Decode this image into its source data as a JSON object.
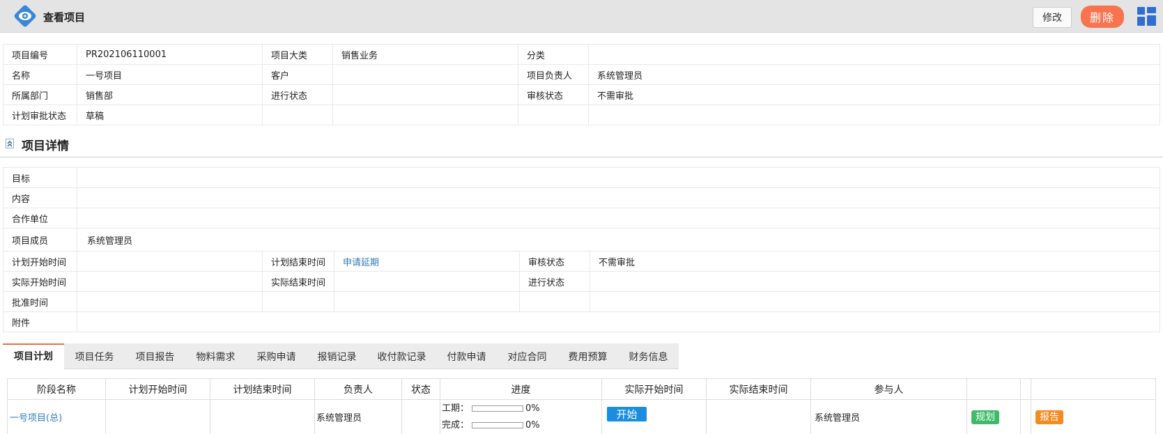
{
  "header": {
    "title": "查看项目",
    "edit_label": "修改",
    "delete_label": "删除",
    "brand_color": "#3a86d8",
    "delete_color": "#f7744f"
  },
  "basic_info": {
    "rows": [
      [
        {
          "label": "项目编号",
          "value": "PR202106110001"
        },
        {
          "label": "项目大类",
          "value": "销售业务"
        },
        {
          "label": "分类",
          "value": ""
        }
      ],
      [
        {
          "label": "名称",
          "value": "一号项目"
        },
        {
          "label": "客户",
          "value": ""
        },
        {
          "label": "项目负责人",
          "value": "系统管理员"
        }
      ],
      [
        {
          "label": "所属部门",
          "value": "销售部"
        },
        {
          "label": "进行状态",
          "value": ""
        },
        {
          "label": "审核状态",
          "value": "不需审批"
        }
      ],
      [
        {
          "label": "计划审批状态",
          "value": "草稿"
        },
        {
          "label": "",
          "value": ""
        },
        {
          "label": "",
          "value": ""
        }
      ]
    ]
  },
  "details": {
    "title": "项目详情",
    "goal_label": "目标",
    "goal_value": "",
    "content_label": "内容",
    "content_value": "",
    "partner_label": "合作单位",
    "partner_value": "",
    "members_label": "项目成员",
    "members_value": "系统管理员",
    "plan_start_label": "计划开始时间",
    "plan_start_value": "",
    "plan_end_label": "计划结束时间",
    "plan_end_link": "申请延期",
    "audit_label": "审核状态",
    "audit_value": "不需审批",
    "actual_start_label": "实际开始时间",
    "actual_start_value": "",
    "actual_end_label": "实际结束时间",
    "actual_end_value": "",
    "progress_status_label": "进行状态",
    "progress_status_value": "",
    "approve_label": "批准时间",
    "approve_value": "",
    "attachment_label": "附件",
    "attachment_value": ""
  },
  "tabs": [
    "项目计划",
    "项目任务",
    "项目报告",
    "物料需求",
    "采购申请",
    "报销记录",
    "收付款记录",
    "付款申请",
    "对应合同",
    "费用预算",
    "财务信息"
  ],
  "active_tab": 0,
  "plan_table": {
    "headers": [
      "阶段名称",
      "计划开始时间",
      "计划结束时间",
      "负责人",
      "状态",
      "进度",
      "实际开始时间",
      "实际结束时间",
      "参与人",
      "",
      "",
      ""
    ],
    "rows": [
      {
        "name": "一号项目(总)",
        "plan_start": "",
        "plan_end": "",
        "owner": "系统管理员",
        "status": "",
        "duration_label": "工期：",
        "duration_pct": "0%",
        "duration_fraction": 0,
        "complete_label": "完成：",
        "complete_pct": "0%",
        "complete_fraction": 0,
        "start_button": "开始",
        "actual_end": "",
        "participants": "系统管理员",
        "plan_badge": "规划",
        "report_badge": "报告"
      }
    ]
  }
}
